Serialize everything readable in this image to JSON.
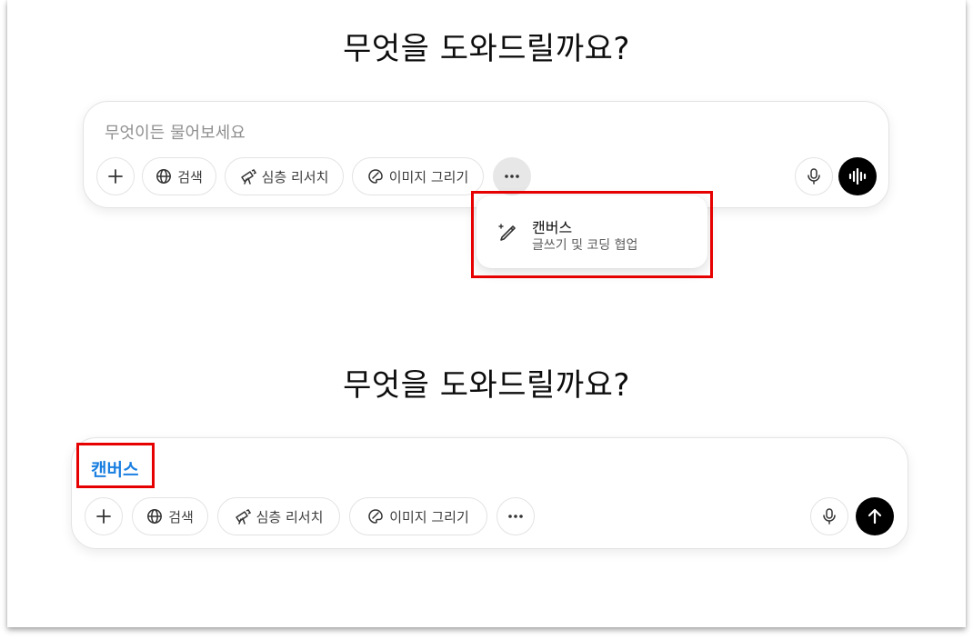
{
  "top_screen": {
    "heading": "무엇을 도와드릴까요?",
    "input_placeholder": "무엇이든 물어보세요",
    "toolbar": {
      "add_label": "+",
      "search_label": "검색",
      "deep_research_label": "심층 리서치",
      "image_label": "이미지 그리기"
    },
    "menu": {
      "item_title": "캔버스",
      "item_subtitle": "글쓰기 및 코딩 협업"
    }
  },
  "bottom_screen": {
    "heading": "무엇을 도와드릴까요?",
    "selected_tool": "캔버스",
    "toolbar": {
      "add_label": "+",
      "search_label": "검색",
      "deep_research_label": "심층 리서치",
      "image_label": "이미지 그리기"
    }
  },
  "colors": {
    "highlight_box": "#e60000",
    "canvas_tag": "#1a7fe0",
    "send_button": "#000000"
  },
  "icons": {
    "add": "plus-icon",
    "search": "globe-icon",
    "deep_research": "telescope-icon",
    "image": "palette-icon",
    "more": "more-dots-icon",
    "mic": "microphone-icon",
    "voice": "voice-wave-icon",
    "send": "arrow-up-icon",
    "canvas": "pen-sparkle-icon"
  }
}
